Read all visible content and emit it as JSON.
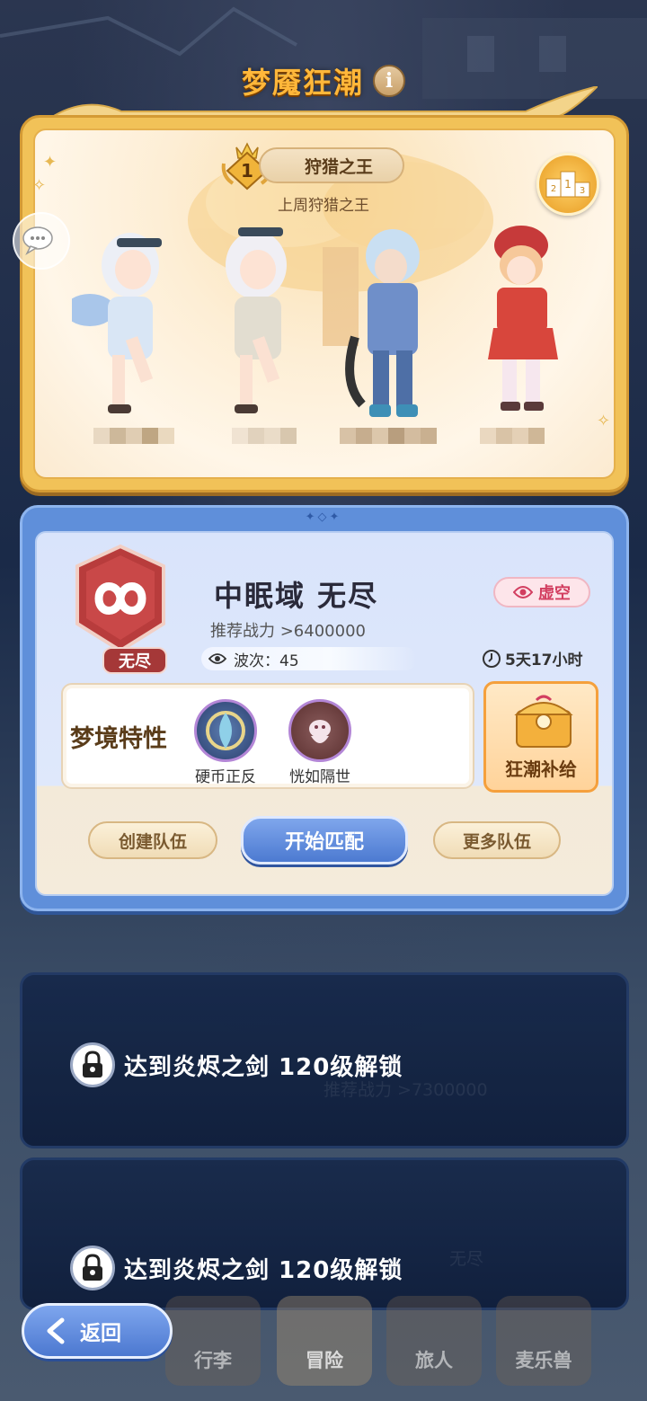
{
  "header": {
    "title": "梦魇狂潮",
    "info_label": "i"
  },
  "hunt": {
    "rank": "1",
    "king_title": "狩猎之王",
    "subtitle": "上周狩猎之王",
    "heroes": [
      "silver-haired-girl",
      "silver-haired-girl-2",
      "blue-haired-boy",
      "red-hat-girl"
    ]
  },
  "mode": {
    "name": "中眠域 无尽",
    "badge": "无尽",
    "element": "虚空",
    "recommended_power": "推荐战力 >6400000",
    "wave_label": "波次：45",
    "timer": "5天17小时",
    "traits_title": "梦境特性",
    "traits": [
      {
        "name": "硬币正反",
        "icon": "coin-icon"
      },
      {
        "name": "恍如隔世",
        "icon": "spirit-icon"
      }
    ],
    "supply_label": "狂潮补给",
    "buttons": {
      "create": "创建队伍",
      "start": "开始匹配",
      "more": "更多队伍"
    }
  },
  "locked": [
    {
      "text": "达到炎烬之剑 120级解锁",
      "ghost": "推荐战力 >7300000"
    },
    {
      "text": "达到炎烬之剑 120级解锁",
      "ghost": "无尽"
    }
  ],
  "nav": {
    "back": "返回",
    "items": [
      "行李",
      "冒险",
      "旅人",
      "麦乐兽"
    ],
    "active": "冒险"
  },
  "colors": {
    "title": "#ffb73a",
    "panel_gold": "#f1c258",
    "panel_blue": "#5f8fda",
    "void": "#d23e60",
    "endless": "#a53838"
  }
}
